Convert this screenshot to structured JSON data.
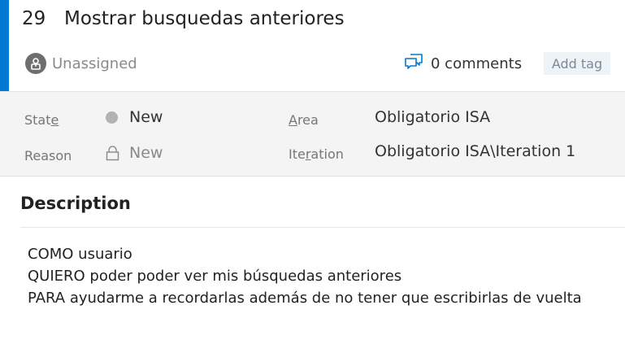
{
  "work_item": {
    "id": "29",
    "title": "Mostrar busquedas anteriores"
  },
  "header": {
    "assignee": "Unassigned",
    "comments": "0 comments",
    "add_tag": "Add tag"
  },
  "fields": {
    "state": {
      "label_pre": "Stat",
      "label_access": "e",
      "label_post": "",
      "value": "New"
    },
    "reason": {
      "label": "Reason",
      "value": "New"
    },
    "area": {
      "label_pre": "",
      "label_access": "A",
      "label_post": "rea",
      "value": "Obligatorio ISA"
    },
    "iteration": {
      "label_pre": "Ite",
      "label_access": "r",
      "label_post": "ation",
      "value": "Obligatorio ISA\\Iteration 1"
    }
  },
  "description": {
    "heading": "Description",
    "lines": [
      "COMO usuario",
      "QUIERO poder poder ver mis búsquedas anteriores",
      "PARA ayudarme a recordarlas además de no tener que escribirlas de vuelta"
    ]
  },
  "colors": {
    "accent": "#0078d4",
    "state_new_dot": "#b2b2b2",
    "panel_bg": "#f4f4f4",
    "tag_bg": "#eef3f8"
  },
  "icons": {
    "avatar": "unassigned-avatar-icon",
    "comments": "comments-icon",
    "reason_lock": "lock-icon",
    "state": "state-dot-icon"
  }
}
